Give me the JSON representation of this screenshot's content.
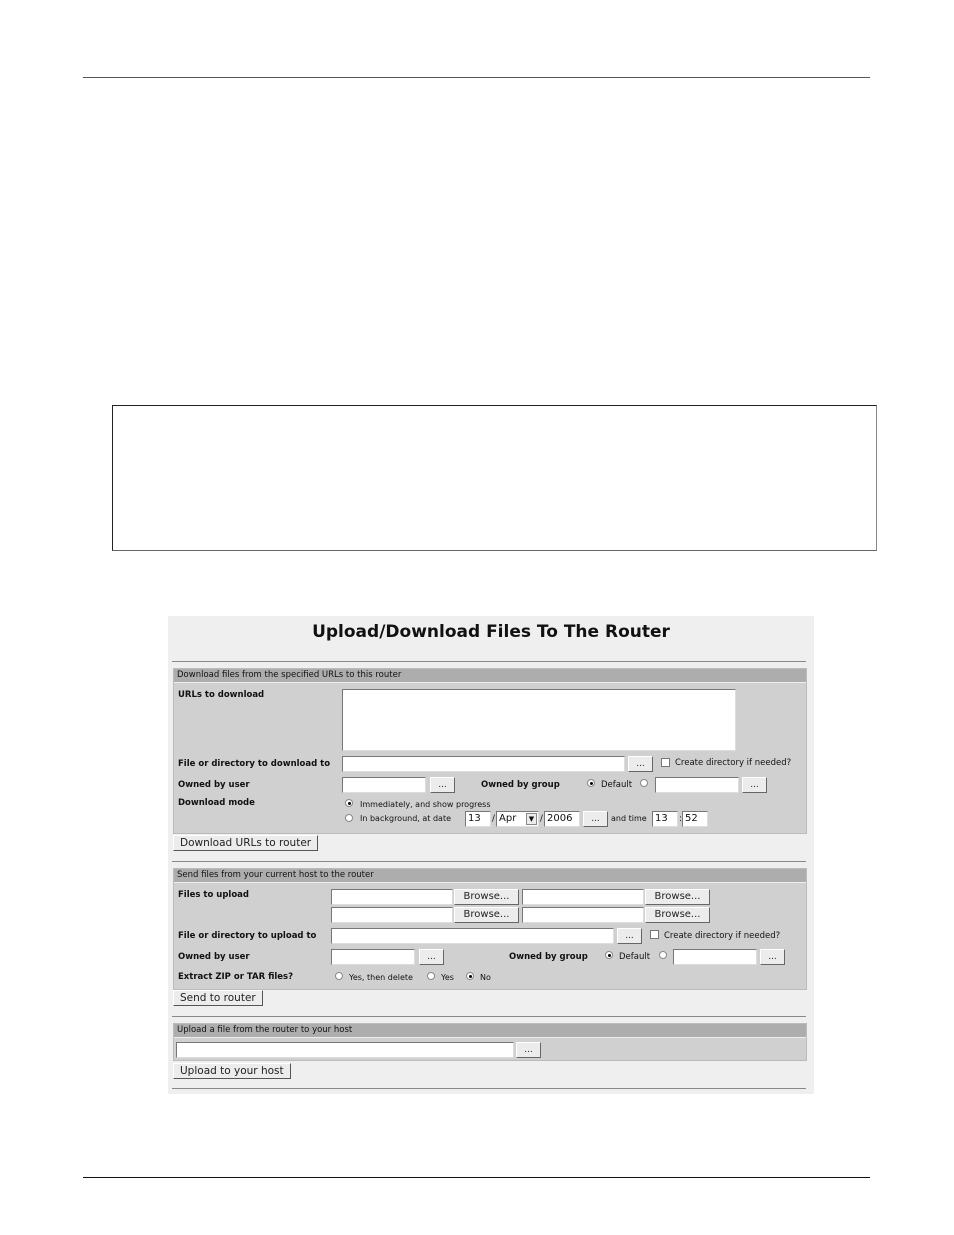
{
  "page": {
    "figure_box_text": ""
  },
  "form": {
    "title": "Upload/Download Files To The Router",
    "download_section": {
      "header": "Download files from the specified URLs to this router",
      "urls_label": "URLs to download",
      "urls_value": "",
      "dest_label": "File or directory to download to",
      "dest_value": "",
      "browse_label": "...",
      "create_dir_label": "Create directory if needed?",
      "owned_user_label": "Owned by user",
      "owned_user_value": "",
      "owned_group_label": "Owned by group",
      "group_default_label": "Default",
      "group_value": "",
      "mode_label": "Download mode",
      "mode_immediate_label": "Immediately, and show progress",
      "mode_background_label": "In background, at date",
      "date_day": "13",
      "date_sep1": "/",
      "date_month": "Apr",
      "date_sep2": "/",
      "date_year": "2006",
      "and_time_label": "and time",
      "time_hour": "13",
      "time_sep": ":",
      "time_minute": "52",
      "submit_label": "Download URLs to router"
    },
    "send_section": {
      "header": "Send files from your current host to the router",
      "files_label": "Files to upload",
      "browse_label": "Browse...",
      "dest_label": "File or directory to upload to",
      "dest_value": "",
      "dots_label": "...",
      "create_dir_label": "Create directory if needed?",
      "owned_user_label": "Owned by user",
      "owned_group_label": "Owned by group",
      "group_default_label": "Default",
      "extract_label": "Extract ZIP or TAR files?",
      "extract_yes_delete": "Yes, then delete",
      "extract_yes": "Yes",
      "extract_no": "No",
      "submit_label": "Send to router"
    },
    "upload_section": {
      "header": "Upload a file from the router to your host",
      "path_value": "",
      "dots_label": "...",
      "submit_label": "Upload to your host"
    }
  }
}
